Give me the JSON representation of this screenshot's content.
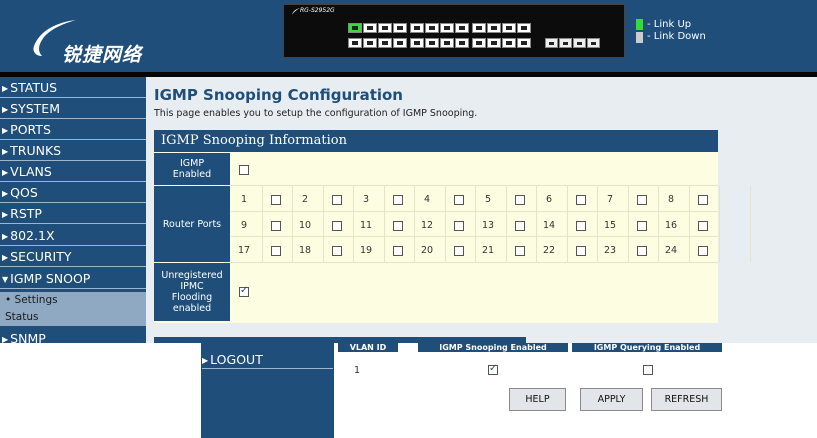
{
  "header": {
    "logo_text": "锐捷网络",
    "switch_brand": "RG-S2952G",
    "legend": {
      "link_up": "- Link Up",
      "link_down": "- Link Down"
    },
    "colors": {
      "link_up": "#33dd33",
      "link_down": "#cccccc",
      "brand": "#1e4e79"
    }
  },
  "sidebar": {
    "items": [
      {
        "label": "STATUS",
        "icon": "triangle-right-icon"
      },
      {
        "label": "SYSTEM",
        "icon": "triangle-right-icon"
      },
      {
        "label": "PORTS",
        "icon": "triangle-right-icon"
      },
      {
        "label": "TRUNKS",
        "icon": "triangle-right-icon"
      },
      {
        "label": "VLANS",
        "icon": "triangle-right-icon"
      },
      {
        "label": "QOS",
        "icon": "triangle-right-icon"
      },
      {
        "label": "RSTP",
        "icon": "triangle-right-icon"
      },
      {
        "label": "802.1X",
        "icon": "triangle-right-icon"
      },
      {
        "label": "SECURITY",
        "icon": "triangle-right-icon"
      },
      {
        "label": "IGMP SNOOP",
        "icon": "triangle-down-icon"
      }
    ],
    "subitems": [
      {
        "label": "• Settings"
      },
      {
        "label": "Status"
      }
    ],
    "snmp": {
      "label": "SNMP"
    },
    "logout": {
      "label": "LOGOUT"
    }
  },
  "main": {
    "title": "IGMP Snooping Configuration",
    "description": "This page enables you to setup the configuration of IGMP Snooping.",
    "section_title": "IGMP Snooping Information",
    "igmp_enabled_label": "IGMP Enabled",
    "igmp_enabled": false,
    "router_ports_label": "Router Ports",
    "router_ports": [
      "1",
      "2",
      "3",
      "4",
      "5",
      "6",
      "7",
      "8",
      "9",
      "10",
      "11",
      "12",
      "13",
      "14",
      "15",
      "16",
      "17",
      "18",
      "19",
      "20",
      "21",
      "22",
      "23",
      "24"
    ],
    "unregistered_label": "Unregistered IPMC Flooding enabled",
    "unregistered_enabled": true
  },
  "status_table": {
    "headers": [
      "VLAN ID",
      "IGMP Snooping Enabled",
      "IGMP Querying Enabled"
    ],
    "rows": [
      {
        "vlan": "1",
        "snooping": true,
        "querying": false
      }
    ]
  },
  "buttons": {
    "help": "HELP",
    "apply": "APPLY",
    "refresh": "REFRESH"
  }
}
